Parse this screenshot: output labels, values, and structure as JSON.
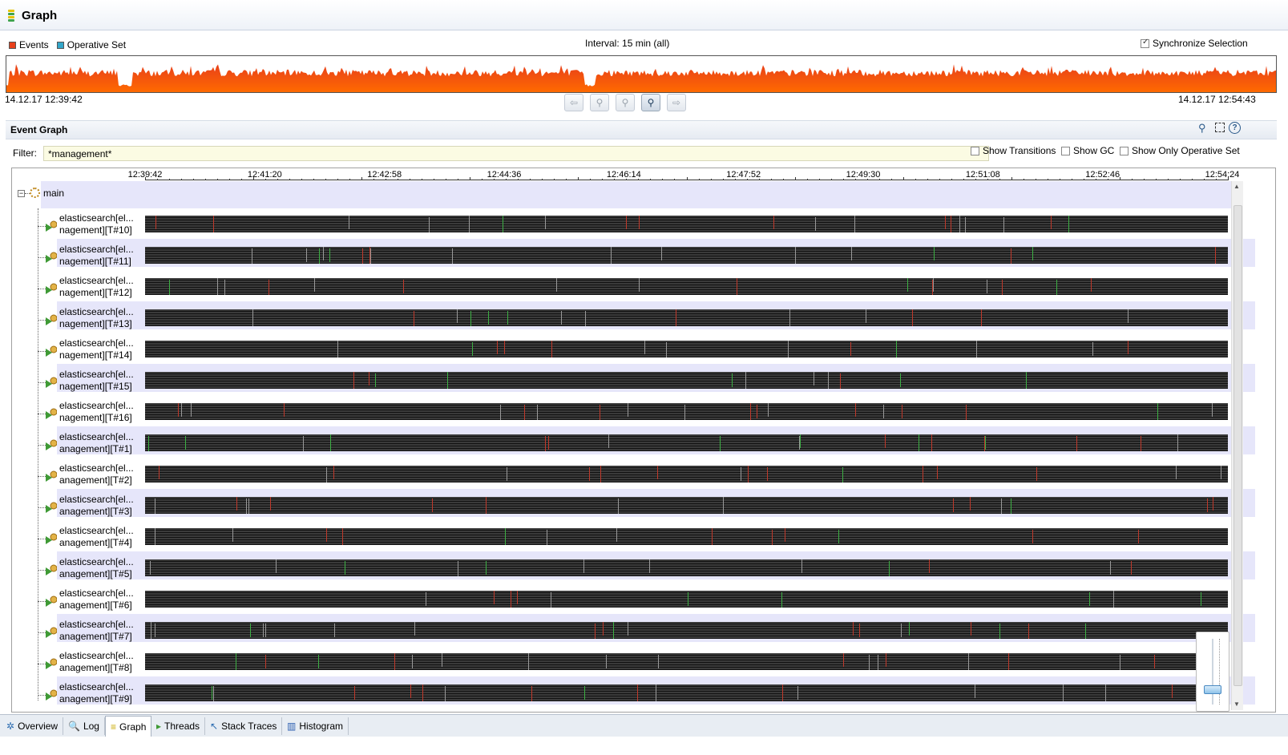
{
  "title": "Graph",
  "legend": [
    {
      "label": "Events",
      "color": "#e8401a"
    },
    {
      "label": "Operative Set",
      "color": "#33a6c9"
    }
  ],
  "interval": "Interval: 15 min (all)",
  "sync": {
    "label": "Synchronize Selection",
    "checked": true
  },
  "range": {
    "start": "14.12.17 12:39:42",
    "end": "14.12.17 12:54:43"
  },
  "section_title": "Event Graph",
  "filter": {
    "label": "Filter:",
    "value": "*management*"
  },
  "options": [
    {
      "label": "Show Transitions",
      "checked": false
    },
    {
      "label": "Show GC",
      "checked": false
    },
    {
      "label": "Show Only Operative Set",
      "checked": false
    }
  ],
  "timeline": [
    "12:39:42",
    "12:41:20",
    "12:42:58",
    "12:44:36",
    "12:46:14",
    "12:47:52",
    "12:49:30",
    "12:51:08",
    "12:52:46",
    "12:54:24"
  ],
  "root_node": "main",
  "threads": [
    {
      "line1": "elasticsearch[el...",
      "line2": "nagement][T#10]"
    },
    {
      "line1": "elasticsearch[el...",
      "line2": "nagement][T#11]"
    },
    {
      "line1": "elasticsearch[el...",
      "line2": "nagement][T#12]"
    },
    {
      "line1": "elasticsearch[el...",
      "line2": "nagement][T#13]"
    },
    {
      "line1": "elasticsearch[el...",
      "line2": "nagement][T#14]"
    },
    {
      "line1": "elasticsearch[el...",
      "line2": "nagement][T#15]"
    },
    {
      "line1": "elasticsearch[el...",
      "line2": "nagement][T#16]"
    },
    {
      "line1": "elasticsearch[el...",
      "line2": "anagement][T#1]"
    },
    {
      "line1": "elasticsearch[el...",
      "line2": "anagement][T#2]"
    },
    {
      "line1": "elasticsearch[el...",
      "line2": "anagement][T#3]"
    },
    {
      "line1": "elasticsearch[el...",
      "line2": "anagement][T#4]"
    },
    {
      "line1": "elasticsearch[el...",
      "line2": "anagement][T#5]"
    },
    {
      "line1": "elasticsearch[el...",
      "line2": "anagement][T#6]"
    },
    {
      "line1": "elasticsearch[el...",
      "line2": "anagement][T#7]"
    },
    {
      "line1": "elasticsearch[el...",
      "line2": "anagement][T#8]"
    },
    {
      "line1": "elasticsearch[el...",
      "line2": "anagement][T#9]"
    }
  ],
  "tabs": [
    {
      "label": "Overview",
      "icon": "overview-icon",
      "active": false
    },
    {
      "label": "Log",
      "icon": "log-icon",
      "active": false
    },
    {
      "label": "Graph",
      "icon": "graph-icon",
      "active": true
    },
    {
      "label": "Threads",
      "icon": "threads-icon",
      "active": false
    },
    {
      "label": "Stack Traces",
      "icon": "stack-traces-icon",
      "active": false
    },
    {
      "label": "Histogram",
      "icon": "histogram-icon",
      "active": false
    }
  ],
  "colors": {
    "event_fill": "#ff6a00",
    "event_line": "#e8401a",
    "thread_bar": "#262626",
    "row_band": "#e6e6fa",
    "marker_red": "#c0392b",
    "marker_green": "#3cb043",
    "marker_gray": "#9a9a9a"
  }
}
